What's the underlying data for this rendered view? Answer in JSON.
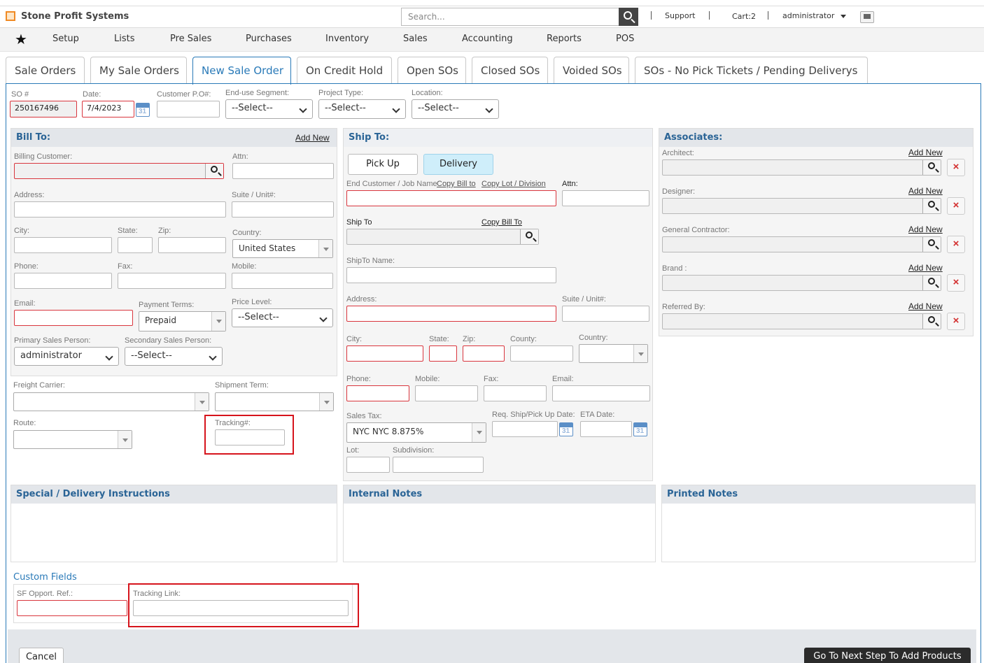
{
  "app": {
    "title": "Stone Profit Systems",
    "search_placeholder": "Search...",
    "support": "Support",
    "cart": "Cart:2",
    "user": "administrator"
  },
  "menu": [
    "Setup",
    "Lists",
    "Pre Sales",
    "Purchases",
    "Inventory",
    "Sales",
    "Accounting",
    "Reports",
    "POS"
  ],
  "tabs": [
    "Sale Orders",
    "My Sale Orders",
    "New Sale Order",
    "On Credit Hold",
    "Open SOs",
    "Closed SOs",
    "Voided SOs",
    "SOs - No Pick Tickets / Pending Deliverys"
  ],
  "header_fields": {
    "so_label": "SO #",
    "so_value": "250167496",
    "date_label": "Date:",
    "date_value": "7/4/2023",
    "po_label": "Customer P.O#:",
    "segment_label": "End-use Segment:",
    "segment_value": "--Select--",
    "project_label": "Project Type:",
    "project_value": "--Select--",
    "location_label": "Location:",
    "location_value": "--Select--",
    "cal_day": "31"
  },
  "bill": {
    "title": "Bill To:",
    "add_new": "Add New",
    "customer": "Billing Customer:",
    "attn": "Attn:",
    "address": "Address:",
    "suite": "Suite / Unit#:",
    "city": "City:",
    "state": "State:",
    "zip": "Zip:",
    "country": "Country:",
    "country_value": "United States",
    "phone": "Phone:",
    "fax": "Fax:",
    "mobile": "Mobile:",
    "email": "Email:",
    "terms": "Payment Terms:",
    "terms_value": "Prepaid",
    "price": "Price Level:",
    "price_value": "--Select--",
    "primary": "Primary Sales Person:",
    "primary_value": "administrator",
    "secondary": "Secondary Sales Person:",
    "secondary_value": "--Select--"
  },
  "shipping_extra": {
    "freight": "Freight Carrier:",
    "term": "Shipment Term:",
    "route": "Route:",
    "tracking": "Tracking#:"
  },
  "ship": {
    "title": "Ship To:",
    "pickup": "Pick Up",
    "delivery": "Delivery",
    "end_customer": "End Customer / Job Name",
    "copy_bill": "Copy Bill to",
    "copy_lot": "Copy Lot / Division",
    "attn": "Attn:",
    "ship_to": "Ship To",
    "copy_bill_to": "Copy Bill To",
    "shipto_name": "ShipTo Name:",
    "address": "Address:",
    "suite": "Suite / Unit#:",
    "city": "City:",
    "state": "State:",
    "zip": "Zip:",
    "county": "County:",
    "country": "Country:",
    "phone": "Phone:",
    "mobile": "Mobile:",
    "fax": "Fax:",
    "email": "Email:",
    "sales_tax": "Sales Tax:",
    "sales_tax_value": "NYC NYC 8.875%",
    "req_date": "Req. Ship/Pick Up Date:",
    "eta": "ETA Date:",
    "lot": "Lot:",
    "subdivision": "Subdivision:"
  },
  "associates": {
    "title": "Associates:",
    "add_new": "Add New",
    "items": [
      "Architect:",
      "Designer:",
      "General Contractor:",
      "Brand :",
      "Referred By:"
    ],
    "remove": "×"
  },
  "notes": {
    "special": "Special / Delivery Instructions",
    "internal": "Internal Notes",
    "printed": "Printed Notes"
  },
  "custom": {
    "title": "Custom Fields",
    "sf": "SF Opport. Ref.:",
    "tracking_link": "Tracking Link:"
  },
  "footer": {
    "cancel": "Cancel",
    "next": "Go To Next Step To Add Products"
  },
  "colors": {
    "accent": "#2a7ab8",
    "required": "#d9363e",
    "highlight": "#d6141c"
  }
}
